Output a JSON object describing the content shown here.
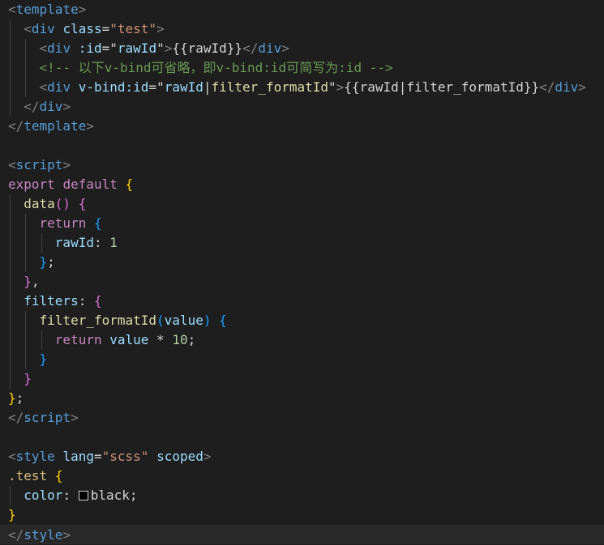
{
  "editor": {
    "swatch_color": "#000000",
    "colors": {
      "background": "#1e1e1e",
      "tag_bracket": "#808080",
      "tag_name": "#569cd6",
      "attribute": "#9cdcfe",
      "string": "#ce9178",
      "comment": "#6a9955",
      "keyword": "#569cd6",
      "control": "#c586c0",
      "function": "#dcdcaa",
      "number": "#b5cea8",
      "selector": "#d7ba7d",
      "bracket_level_1": "#ffd700",
      "bracket_level_2": "#da70d6",
      "bracket_level_3": "#179fff"
    },
    "lines": [
      {
        "tokens": [
          {
            "text": "<",
            "c": "tag"
          },
          {
            "text": "template",
            "c": "el"
          },
          {
            "text": ">",
            "c": "tag"
          }
        ]
      },
      {
        "tokens": [
          {
            "text": "  ",
            "c": "txt"
          },
          {
            "text": "<",
            "c": "tag"
          },
          {
            "text": "div",
            "c": "el"
          },
          {
            "text": " ",
            "c": "txt"
          },
          {
            "text": "class",
            "c": "attr"
          },
          {
            "text": "=",
            "c": "txt"
          },
          {
            "text": "\"test\"",
            "c": "str"
          },
          {
            "text": ">",
            "c": "tag"
          }
        ]
      },
      {
        "tokens": [
          {
            "text": "    ",
            "c": "txt"
          },
          {
            "text": "<",
            "c": "tag"
          },
          {
            "text": "div",
            "c": "el"
          },
          {
            "text": " ",
            "c": "txt"
          },
          {
            "text": ":id",
            "c": "attr"
          },
          {
            "text": "=",
            "c": "txt"
          },
          {
            "text": "\"",
            "c": "txt"
          },
          {
            "text": "rawId",
            "c": "attr"
          },
          {
            "text": "\"",
            "c": "txt"
          },
          {
            "text": ">",
            "c": "tag"
          },
          {
            "text": "{{rawId}}",
            "c": "txt"
          },
          {
            "text": "</",
            "c": "tag"
          },
          {
            "text": "div",
            "c": "el"
          },
          {
            "text": ">",
            "c": "tag"
          }
        ]
      },
      {
        "tokens": [
          {
            "text": "    ",
            "c": "txt"
          },
          {
            "text": "<!-- 以下v-bind可省略，即v-bind:id可简写为:id -->",
            "c": "cmt"
          }
        ]
      },
      {
        "tokens": [
          {
            "text": "    ",
            "c": "txt"
          },
          {
            "text": "<",
            "c": "tag"
          },
          {
            "text": "div",
            "c": "el"
          },
          {
            "text": " ",
            "c": "txt"
          },
          {
            "text": "v-bind:id",
            "c": "attr"
          },
          {
            "text": "=",
            "c": "txt"
          },
          {
            "text": "\"",
            "c": "txt"
          },
          {
            "text": "rawId",
            "c": "attr"
          },
          {
            "text": "|",
            "c": "txt"
          },
          {
            "text": "filter_formatId",
            "c": "fn"
          },
          {
            "text": "\"",
            "c": "txt"
          },
          {
            "text": ">",
            "c": "tag"
          },
          {
            "text": "{{rawId|filter_formatId}}",
            "c": "txt"
          },
          {
            "text": "</",
            "c": "tag"
          },
          {
            "text": "div",
            "c": "el"
          },
          {
            "text": ">",
            "c": "tag"
          }
        ]
      },
      {
        "tokens": [
          {
            "text": "  ",
            "c": "txt"
          },
          {
            "text": "</",
            "c": "tag"
          },
          {
            "text": "div",
            "c": "el"
          },
          {
            "text": ">",
            "c": "tag"
          }
        ]
      },
      {
        "tokens": [
          {
            "text": "</",
            "c": "tag"
          },
          {
            "text": "template",
            "c": "el"
          },
          {
            "text": ">",
            "c": "tag"
          }
        ]
      },
      {
        "tokens": []
      },
      {
        "tokens": [
          {
            "text": "<",
            "c": "tag"
          },
          {
            "text": "script",
            "c": "el"
          },
          {
            "text": ">",
            "c": "tag"
          }
        ]
      },
      {
        "tokens": [
          {
            "text": "export",
            "c": "ctl"
          },
          {
            "text": " ",
            "c": "txt"
          },
          {
            "text": "default",
            "c": "ctl"
          },
          {
            "text": " ",
            "c": "txt"
          },
          {
            "text": "{",
            "c": "b1"
          }
        ]
      },
      {
        "tokens": [
          {
            "text": "  ",
            "c": "txt"
          },
          {
            "text": "data",
            "c": "fn"
          },
          {
            "text": "()",
            "c": "b2"
          },
          {
            "text": " ",
            "c": "txt"
          },
          {
            "text": "{",
            "c": "b2"
          }
        ]
      },
      {
        "tokens": [
          {
            "text": "    ",
            "c": "txt"
          },
          {
            "text": "return",
            "c": "ctl"
          },
          {
            "text": " ",
            "c": "txt"
          },
          {
            "text": "{",
            "c": "b3"
          }
        ]
      },
      {
        "tokens": [
          {
            "text": "      ",
            "c": "txt"
          },
          {
            "text": "rawId",
            "c": "attr"
          },
          {
            "text": ": ",
            "c": "txt"
          },
          {
            "text": "1",
            "c": "num"
          }
        ]
      },
      {
        "tokens": [
          {
            "text": "    ",
            "c": "txt"
          },
          {
            "text": "}",
            "c": "b3"
          },
          {
            "text": ";",
            "c": "txt"
          }
        ]
      },
      {
        "tokens": [
          {
            "text": "  ",
            "c": "txt"
          },
          {
            "text": "}",
            "c": "b2"
          },
          {
            "text": ",",
            "c": "txt"
          }
        ]
      },
      {
        "tokens": [
          {
            "text": "  ",
            "c": "txt"
          },
          {
            "text": "filters",
            "c": "attr"
          },
          {
            "text": ": ",
            "c": "txt"
          },
          {
            "text": "{",
            "c": "b2"
          }
        ]
      },
      {
        "tokens": [
          {
            "text": "    ",
            "c": "txt"
          },
          {
            "text": "filter_formatId",
            "c": "fn"
          },
          {
            "text": "(",
            "c": "b3"
          },
          {
            "text": "value",
            "c": "attr"
          },
          {
            "text": ")",
            "c": "b3"
          },
          {
            "text": " ",
            "c": "txt"
          },
          {
            "text": "{",
            "c": "b3"
          }
        ]
      },
      {
        "tokens": [
          {
            "text": "      ",
            "c": "txt"
          },
          {
            "text": "return",
            "c": "ctl"
          },
          {
            "text": " ",
            "c": "txt"
          },
          {
            "text": "value",
            "c": "attr"
          },
          {
            "text": " * ",
            "c": "txt"
          },
          {
            "text": "10",
            "c": "num"
          },
          {
            "text": ";",
            "c": "txt"
          }
        ]
      },
      {
        "tokens": [
          {
            "text": "    ",
            "c": "txt"
          },
          {
            "text": "}",
            "c": "b3"
          }
        ]
      },
      {
        "tokens": [
          {
            "text": "  ",
            "c": "txt"
          },
          {
            "text": "}",
            "c": "b2"
          }
        ]
      },
      {
        "tokens": [
          {
            "text": "}",
            "c": "b1"
          },
          {
            "text": ";",
            "c": "txt"
          }
        ]
      },
      {
        "tokens": [
          {
            "text": "</",
            "c": "tag"
          },
          {
            "text": "script",
            "c": "el"
          },
          {
            "text": ">",
            "c": "tag"
          }
        ]
      },
      {
        "tokens": []
      },
      {
        "tokens": [
          {
            "text": "<",
            "c": "tag"
          },
          {
            "text": "style",
            "c": "el"
          },
          {
            "text": " ",
            "c": "txt"
          },
          {
            "text": "lang",
            "c": "attr"
          },
          {
            "text": "=",
            "c": "txt"
          },
          {
            "text": "\"scss\"",
            "c": "str"
          },
          {
            "text": " ",
            "c": "txt"
          },
          {
            "text": "scoped",
            "c": "attr"
          },
          {
            "text": ">",
            "c": "tag"
          }
        ]
      },
      {
        "tokens": [
          {
            "text": ".test",
            "c": "cls"
          },
          {
            "text": " ",
            "c": "txt"
          },
          {
            "text": "{",
            "c": "b1"
          }
        ]
      },
      {
        "tokens": [
          {
            "text": "  ",
            "c": "txt"
          },
          {
            "text": "color",
            "c": "attr"
          },
          {
            "text": ": ",
            "c": "txt"
          },
          {
            "text": "",
            "c": "swatch"
          },
          {
            "text": "black",
            "c": "txt"
          },
          {
            "text": ";",
            "c": "txt"
          }
        ]
      },
      {
        "tokens": [
          {
            "text": "}",
            "c": "b1"
          }
        ]
      },
      {
        "tokens": [
          {
            "text": "</",
            "c": "tag"
          },
          {
            "text": "style",
            "c": "el"
          },
          {
            "text": ">",
            "c": "tag"
          }
        ]
      }
    ]
  }
}
